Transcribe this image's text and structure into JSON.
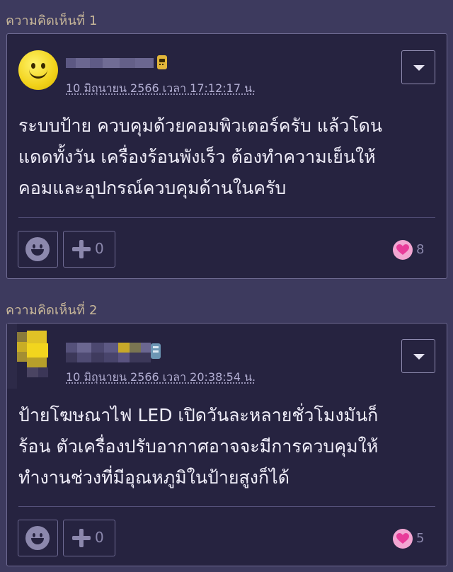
{
  "comments": [
    {
      "heading": "ความคิดเห็นที่ 1",
      "timestamp": "10 มิถุนายน 2566 เวลา 17:12:17 น.",
      "body": [
        "ระบบป้าย ควบคุมด้วยคอมพิวเตอร์ครับ แล้วโดน",
        "แดดทั้งวัน เครื่องร้อนพังเร็ว  ต้องทำความเย็นให้",
        "คอมและอุปกรณ์ควบคุมด้านในครับ"
      ],
      "plus_count": "0",
      "heart_count": "8",
      "avatar_icon": "smiley-face-avatar",
      "badge_icon": "walkie-talkie-icon"
    },
    {
      "heading": "ความคิดเห็นที่ 2",
      "timestamp": "10 มิถุนายน 2566 เวลา 20:38:54 น.",
      "body": [
        "ป้ายโฆษณาไฟ LED เปิดวันละหลายชั่วโมงมันก็",
        "ร้อน ตัวเครื่องปรับอากาศอาจจะมีการควบคุมให้",
        "ทำงานช่วงที่มีอุณหภูมิในป้ายสูงก็ได้"
      ],
      "plus_count": "0",
      "heart_count": "5",
      "avatar_icon": "pixelated-avatar",
      "badge_icon": "member-badge-icon"
    }
  ],
  "colors": {
    "background": "#3d3a5e",
    "card": "#262340",
    "heading": "#c9b89a",
    "timestamp": "#b2aed2",
    "heart": "#f2a6d2"
  }
}
